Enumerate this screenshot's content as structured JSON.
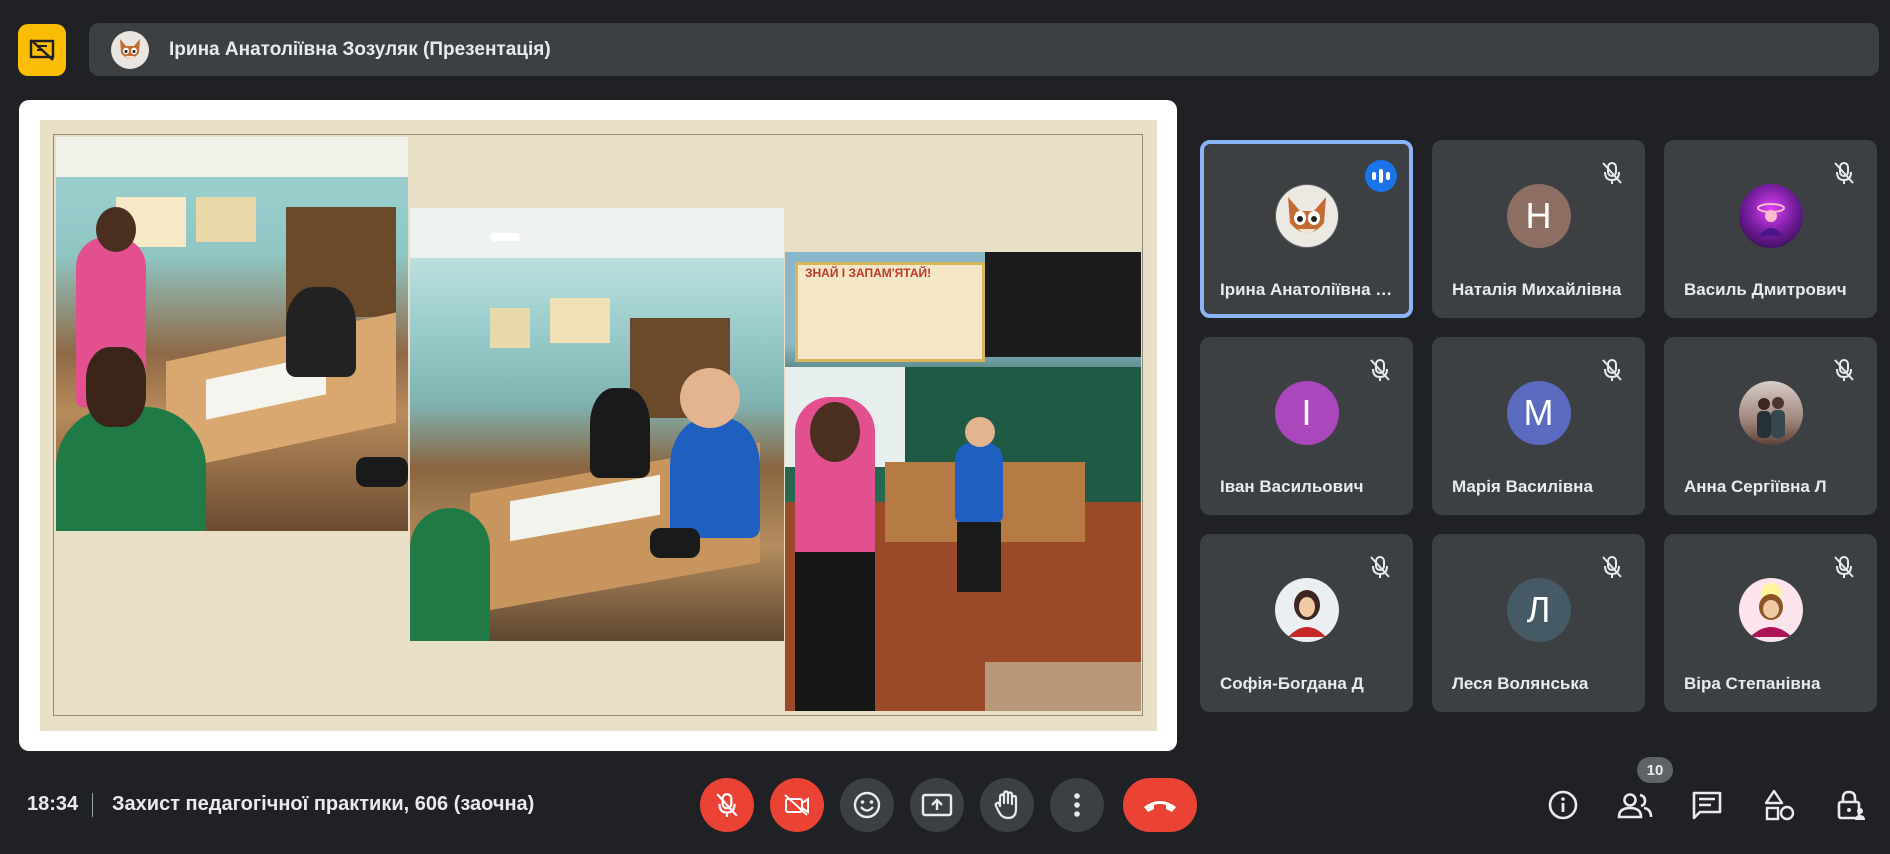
{
  "header": {
    "presenter_title": "Ірина Анатоліївна Зозуляк (Презентація)",
    "pin_icon": "unpin-presentation-icon"
  },
  "presentation": {
    "photos": [
      "classroom-photo",
      "classroom-photo",
      "classroom-blackboard-photo"
    ],
    "board_text": "ЗНАЙ І ЗАПАМ'ЯТАЙ!"
  },
  "participants": [
    {
      "name": "Ірина Анатоліївна Зозуляк",
      "initial": "",
      "avatar_color": "#5f6368",
      "speaking": true,
      "muted": false
    },
    {
      "name": "Наталія Михайлівна",
      "initial": "Н",
      "avatar_color": "#8d6e63",
      "speaking": false,
      "muted": true
    },
    {
      "name": "Василь Дмитрович",
      "initial": "",
      "avatar_color": "#6a1b9a",
      "speaking": false,
      "muted": true
    },
    {
      "name": "Іван Васильович",
      "initial": "І",
      "avatar_color": "#ab47bc",
      "speaking": false,
      "muted": true
    },
    {
      "name": "Марія Василівна",
      "initial": "М",
      "avatar_color": "#5c6bc0",
      "speaking": false,
      "muted": true
    },
    {
      "name": "Анна Сергіївна Л",
      "initial": "",
      "avatar_color": "#a1887f",
      "speaking": false,
      "muted": true
    },
    {
      "name": "Софія-Богдана Д",
      "initial": "",
      "avatar_color": "#c62828",
      "speaking": false,
      "muted": true
    },
    {
      "name": "Леся Волянська",
      "initial": "Л",
      "avatar_color": "#455a64",
      "speaking": false,
      "muted": true
    },
    {
      "name": "Віра Степанівна",
      "initial": "",
      "avatar_color": "#f48fb1",
      "speaking": false,
      "muted": true
    }
  ],
  "footer": {
    "time": "18:34",
    "meeting_name": "Захист педагогічної практики, 606 (заочна)",
    "participant_count": "10"
  },
  "controls": {
    "mic": "mic-off-icon",
    "camera": "camera-off-icon",
    "emoji": "emoji-icon",
    "present": "present-screen-icon",
    "raise_hand": "raise-hand-icon",
    "more": "more-options-icon",
    "hangup": "hang-up-icon"
  },
  "colors": {
    "background": "#202124",
    "tile": "#3c4043",
    "accent_red": "#ea4335",
    "pin_yellow": "#fbbc04",
    "active_border": "#8ab4f8"
  }
}
